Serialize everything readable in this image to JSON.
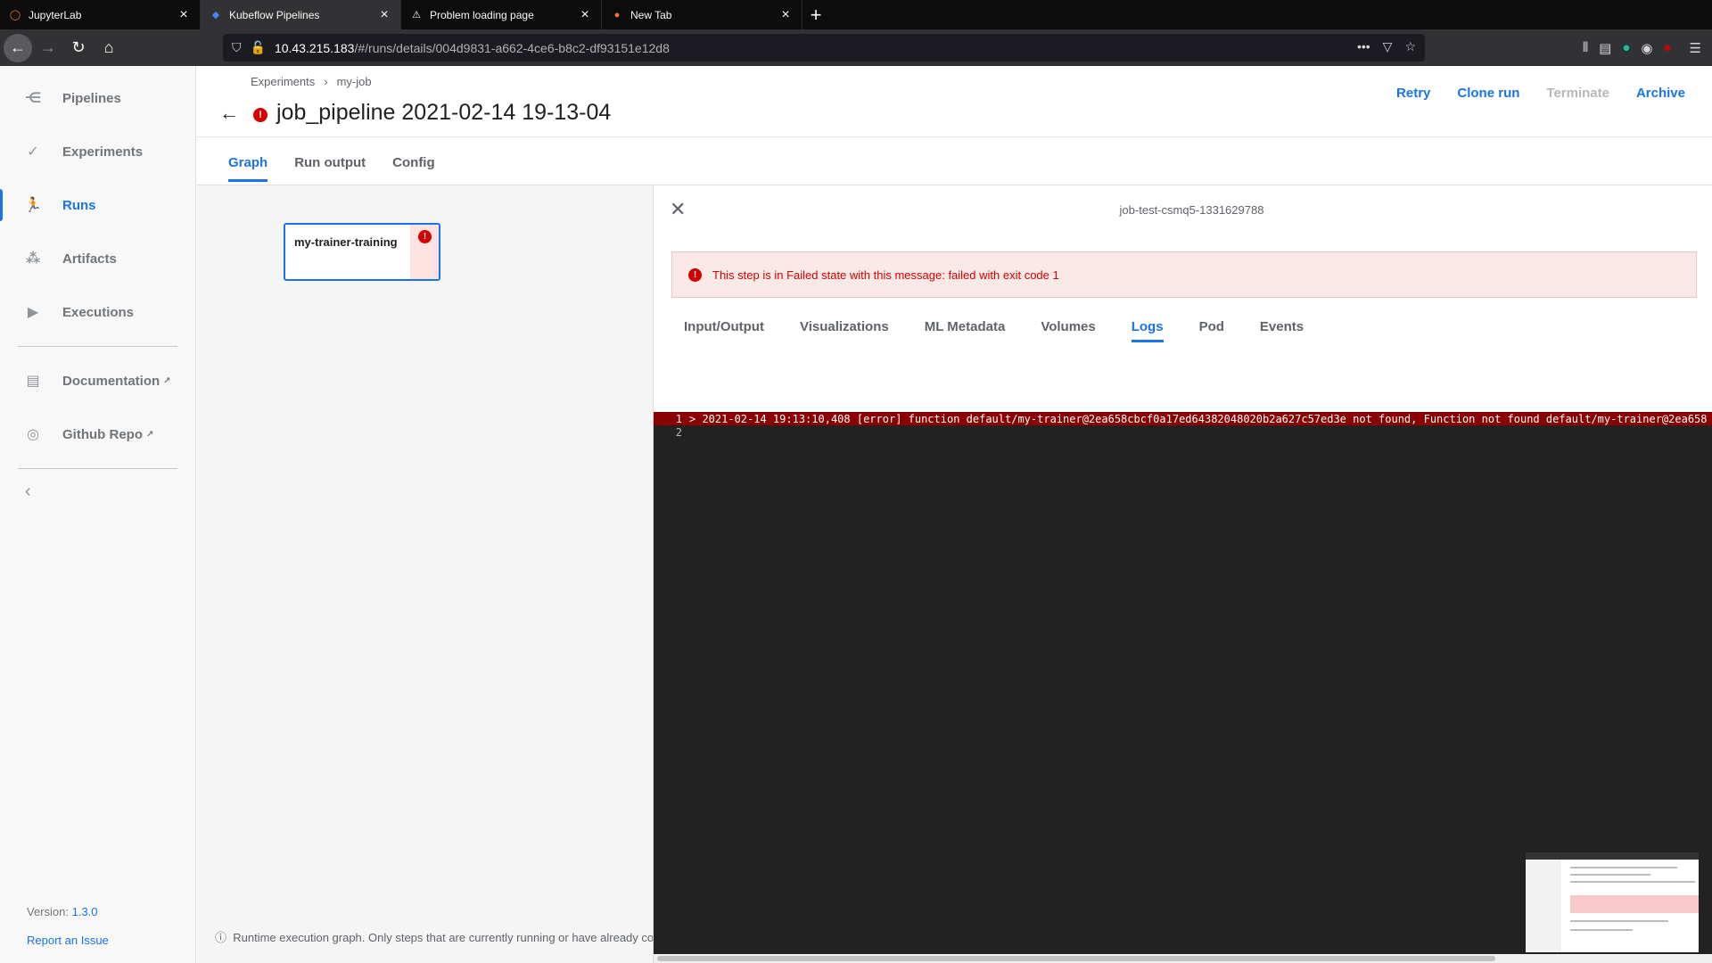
{
  "browser": {
    "tabs": [
      {
        "title": "JupyterLab",
        "active": false
      },
      {
        "title": "Kubeflow Pipelines",
        "active": true
      },
      {
        "title": "Problem loading page",
        "active": false
      },
      {
        "title": "New Tab",
        "active": false
      }
    ],
    "url_host": "10.43.215.183",
    "url_path": "/#/runs/details/004d9831-a662-4ce6-b8c2-df93151e12d8"
  },
  "sidebar": {
    "items": [
      {
        "label": "Pipelines",
        "icon": "pipelines-icon"
      },
      {
        "label": "Experiments",
        "icon": "experiments-icon"
      },
      {
        "label": "Runs",
        "icon": "runs-icon",
        "active": true
      },
      {
        "label": "Artifacts",
        "icon": "artifacts-icon"
      },
      {
        "label": "Executions",
        "icon": "executions-icon"
      }
    ],
    "links": [
      {
        "label": "Documentation",
        "icon": "documentation-icon"
      },
      {
        "label": "Github Repo",
        "icon": "github-icon"
      }
    ],
    "version_label": "Version:",
    "version_value": "1.3.0",
    "report_issue": "Report an Issue"
  },
  "header": {
    "breadcrumbs": [
      "Experiments",
      "my-job"
    ],
    "title": "job_pipeline 2021-02-14 19-13-04",
    "actions": {
      "retry": "Retry",
      "clone": "Clone run",
      "terminate": "Terminate",
      "archive": "Archive"
    }
  },
  "tabs": [
    "Graph",
    "Run output",
    "Config"
  ],
  "graph": {
    "node_name": "my-trainer-training",
    "note": "Runtime execution graph. Only steps that are currently running or have already comp"
  },
  "details": {
    "node_id": "job-test-csmq5-1331629788",
    "error_message": "This step is in Failed state with this message: failed with exit code 1",
    "tabs": [
      "Input/Output",
      "Visualizations",
      "ML Metadata",
      "Volumes",
      "Logs",
      "Pod",
      "Events"
    ],
    "active_tab": "Logs",
    "log_lines": [
      {
        "n": "1",
        "text": "> 2021-02-14 19:13:10,408 [error] function default/my-trainer@2ea658cbcf0a17ed64382048020b2a627c57ed3e not found, Function not found default/my-trainer@2ea658",
        "error": true
      },
      {
        "n": "2",
        "text": "",
        "error": false
      }
    ]
  }
}
